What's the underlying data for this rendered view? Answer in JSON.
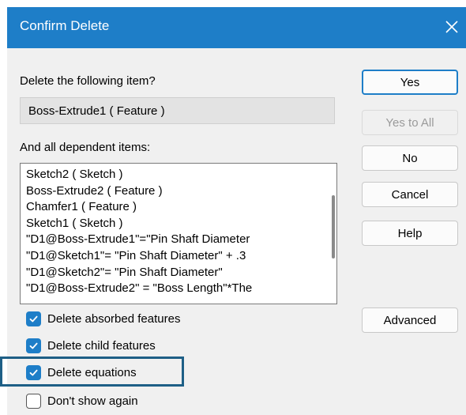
{
  "dialog": {
    "title": "Confirm Delete",
    "delete_prompt": "Delete the following item?",
    "item_value": "Boss-Extrude1 ( Feature )",
    "dependents_label": "And all dependent items:",
    "dependent_items": [
      "Sketch2 ( Sketch )",
      "Boss-Extrude2 ( Feature )",
      "Chamfer1 ( Feature )",
      "Sketch1 ( Sketch )",
      "\"D1@Boss-Extrude1\"=\"Pin Shaft Diameter",
      "\"D1@Sketch1\"= \"Pin Shaft Diameter\" + .3",
      "\"D1@Sketch2\"= \"Pin Shaft Diameter\"",
      "\"D1@Boss-Extrude2\" = \"Boss Length\"*The"
    ]
  },
  "buttons": {
    "yes": "Yes",
    "yes_to_all": "Yes to All",
    "no": "No",
    "cancel": "Cancel",
    "help": "Help",
    "advanced": "Advanced"
  },
  "options": [
    {
      "label": "Delete absorbed features",
      "checked": true
    },
    {
      "label": "Delete child features",
      "checked": true
    },
    {
      "label": "Delete equations",
      "checked": true
    },
    {
      "label": "Don't show again",
      "checked": false
    }
  ],
  "colors": {
    "accent": "#1e7ec8",
    "highlight": "#1e5f86",
    "dialog_bg": "#f0f0f0"
  },
  "icons": {
    "close": "close-icon",
    "check": "checkmark-icon"
  }
}
